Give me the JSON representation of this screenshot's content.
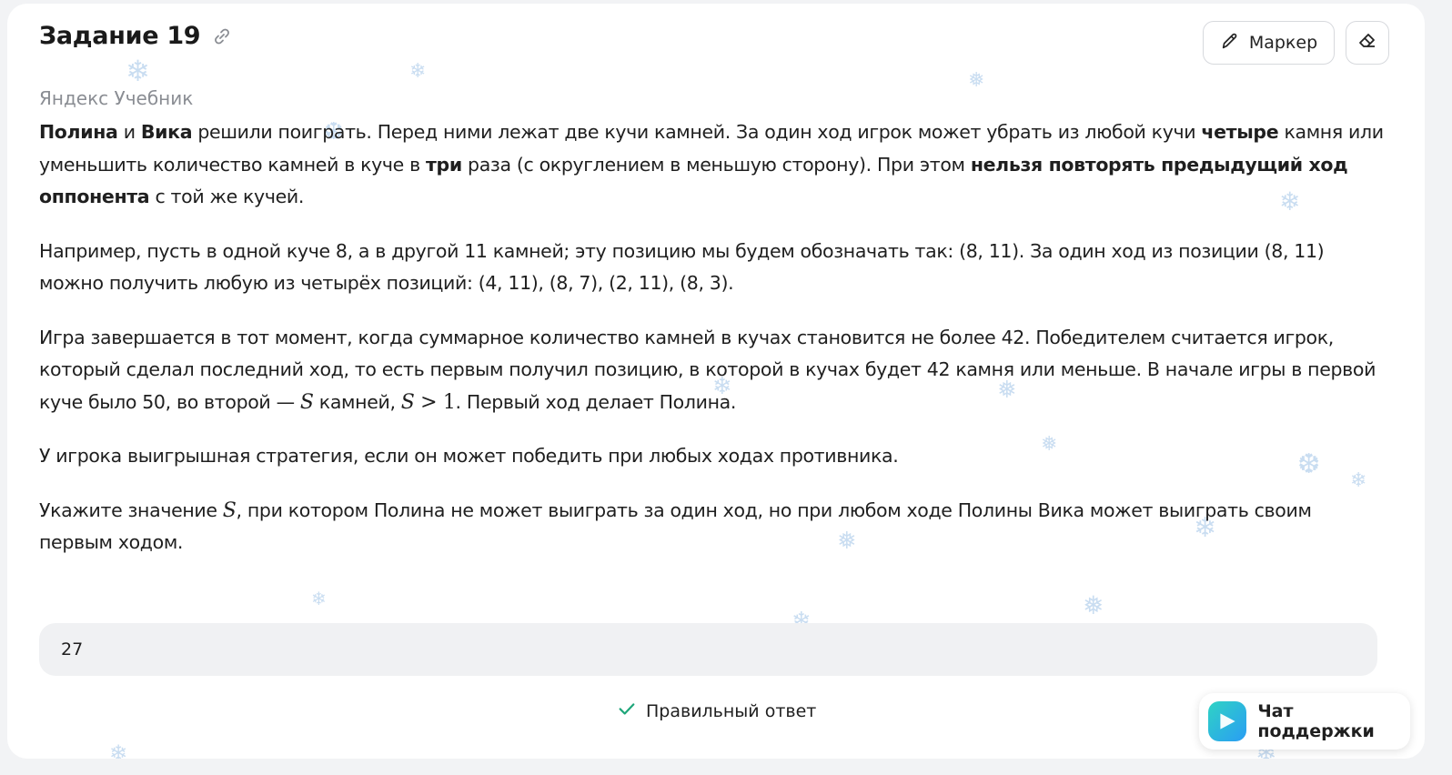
{
  "task": {
    "title": "Задание 19",
    "source": "Яндекс Учебник"
  },
  "toolbar": {
    "marker_label": "Маркер"
  },
  "problem": {
    "p1": {
      "s1": "Полина",
      "s2": " и ",
      "s3": "Вика",
      "s4": " решили поиграть. Перед ними лежат две кучи камней. За один ход игрок может убрать из любой кучи ",
      "s5": "четыре",
      "s6": " камня или уменьшить количество камней в куче в ",
      "s7": "три",
      "s8": " раза (с округлением в меньшую сторону). При этом ",
      "s9": "нельзя повторять предыдущий ход оппонента",
      "s10": " с той же кучей."
    },
    "p2": "Например, пусть в одной куче 8, а в другой 11 камней; эту позицию мы будем обозначать так: (8, 11). За один ход из позиции (8, 11) можно получить любую из четырёх позиций: (4, 11), (8, 7), (2, 11), (8, 3).",
    "p3": {
      "s1": "Игра завершается в тот момент, когда суммарное количество камней в кучах становится не более 42. Победителем считается игрок, который сделал последний ход, то есть первым получил позицию, в которой в кучах будет 42 камня или меньше. В начале игры в первой куче было 50, во второй — ",
      "m1": "S",
      "s2": " камней, ",
      "m2": "S",
      "m3": " > 1",
      "s3": ". Первый ход делает Полина."
    },
    "p4": "У игрока выигрышная стратегия, если он может победить при любых ходах противника.",
    "p5": {
      "s1": "Укажите значение ",
      "m1": "S",
      "s2": ", при котором Полина не может выиграть за один ход, но при любом ходе Полины Вика может выиграть своим первым ходом."
    }
  },
  "answer": {
    "value": "27",
    "status": "Правильный ответ",
    "status_color": "#1fa67a"
  },
  "support": {
    "chat_label": "Чат поддержки"
  },
  "icons": {
    "link": "link-icon",
    "marker": "pencil-icon",
    "eraser": "eraser-icon",
    "check": "check-icon",
    "chat": "chat-logo-icon"
  }
}
